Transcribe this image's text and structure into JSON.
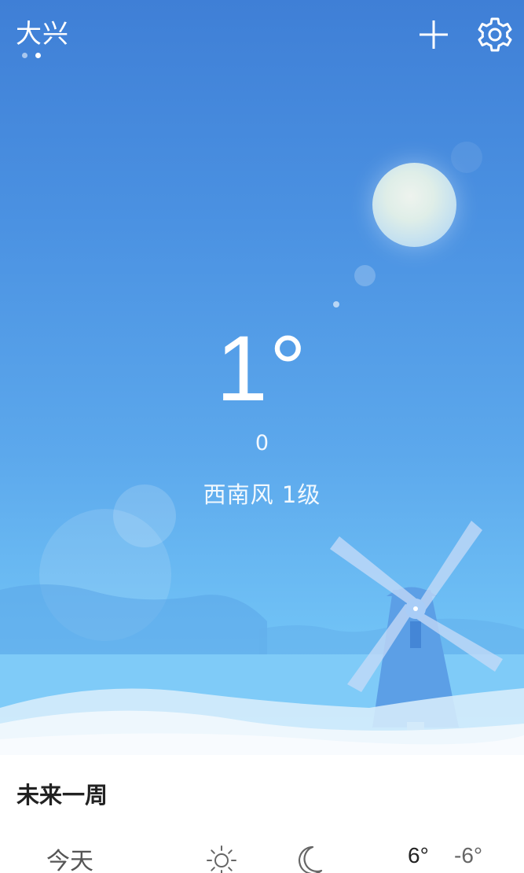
{
  "header": {
    "city": "大兴",
    "page_count": 2,
    "active_page": 2,
    "add_icon": "plus-icon",
    "settings_icon": "gear-icon"
  },
  "current": {
    "temperature": "1°",
    "aqi": "0",
    "wind": "西南风 1级"
  },
  "forecast": {
    "title": "未来一周",
    "days": [
      {
        "name": "今天",
        "day_icon": "sun-icon",
        "night_icon": "moon-icon",
        "high": "6°",
        "low": "-6°"
      }
    ]
  },
  "colors": {
    "sky_top": "#3f7fd6",
    "sky_bottom": "#86d2fb",
    "text": "#ffffff"
  }
}
